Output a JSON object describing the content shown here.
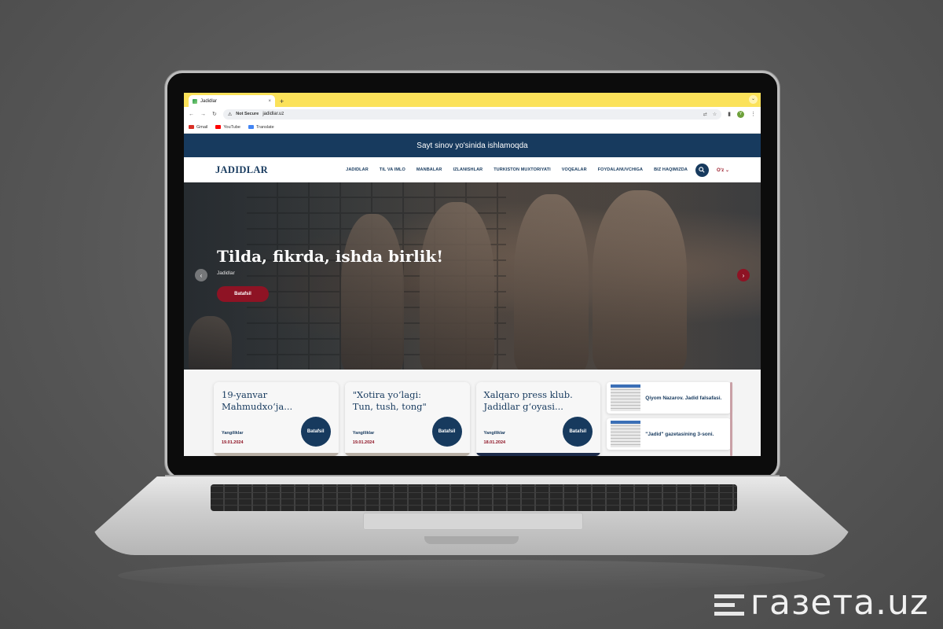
{
  "browser": {
    "tab_title": "Jadidlar",
    "tab_close": "×",
    "new_tab": "+",
    "tab_menu": "⌄",
    "not_secure": "Not Secure",
    "url": "jadidlar.uz",
    "profile_initial": "Y",
    "bookmarks": [
      {
        "label": "Gmail",
        "color": "#d93025"
      },
      {
        "label": "YouTube",
        "color": "#ff0000"
      },
      {
        "label": "Translate",
        "color": "#4285f4"
      }
    ]
  },
  "site": {
    "notice": "Sayt sinov yo'sinida ishlamoqda",
    "logo": "JADIDLAR",
    "menu": [
      "JADIDLAR",
      "TIL VA IMLO",
      "MANBALAR",
      "IZLANISHLAR",
      "TURKISTON MUXTORIYATI",
      "VOQEALAR",
      "FOYDALANUVCHIGA",
      "BIZ HAQIMIZDA"
    ],
    "language": "O‘z ⌄",
    "hero": {
      "title": "Tilda, fikrda, ishda birlik!",
      "subtitle": "Jadidlar",
      "button": "Batafsil"
    },
    "cards": [
      {
        "title": "19-yanvar Mahmudxo‘ja...",
        "category": "Yangiliklar",
        "date": "19.01.2024",
        "button": "Batafsil"
      },
      {
        "title": "\"Xotira yo‘lagi: Tun, tush, tong\"",
        "category": "Yangiliklar",
        "date": "19.01.2024",
        "button": "Batafsil"
      },
      {
        "title": "Xalqaro press klub. Jadidlar g‘oyasi...",
        "category": "Yangiliklar",
        "date": "18.01.2024",
        "button": "Batafsil"
      }
    ],
    "side_items": [
      {
        "label": "Qiyom Nazarov. Jadid falsafasi."
      },
      {
        "label": "\"Jadid\" gazetasining 3-soni."
      }
    ]
  },
  "watermark": "газета.uz",
  "colors": {
    "navy": "#173a5e",
    "accent_red": "#8e1324",
    "tab_yellow": "#fbe25a"
  }
}
